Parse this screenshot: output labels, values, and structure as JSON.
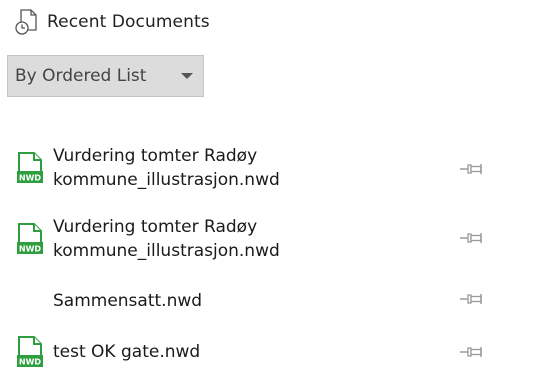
{
  "header": {
    "title": "Recent Documents",
    "icon": "recent-documents-icon"
  },
  "sort_dropdown": {
    "selected": "By Ordered List"
  },
  "files": [
    {
      "name": "Vurdering tomter Radøy\nkommune_illustrasjon.nwd",
      "icon": "nwd-file-icon"
    },
    {
      "name": "Vurdering tomter Radøy\nkommune_illustrasjon.nwd",
      "icon": "nwd-file-icon"
    },
    {
      "name": "Sammensatt.nwd",
      "icon": "none"
    },
    {
      "name": "test OK gate.nwd",
      "icon": "nwd-file-icon"
    }
  ],
  "colors": {
    "nwd_icon_green": "#2e9e3e",
    "dropdown_bg": "#dcdcdc",
    "pin_gray": "#9a9a9a"
  }
}
